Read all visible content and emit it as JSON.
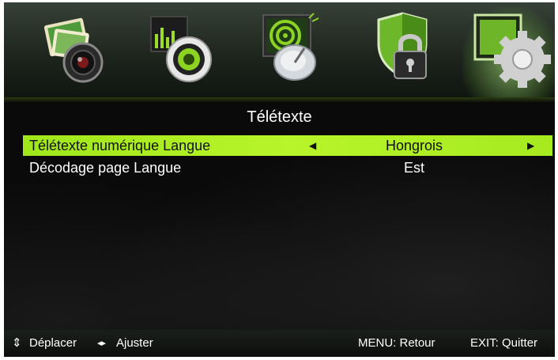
{
  "tabs": [
    {
      "icon": "picture-camera-icon"
    },
    {
      "icon": "sound-speaker-icon"
    },
    {
      "icon": "channel-satellite-icon"
    },
    {
      "icon": "lock-shield-icon"
    },
    {
      "icon": "settings-gear-icon",
      "active": true
    }
  ],
  "menu": {
    "title": "Télétexte",
    "items": [
      {
        "label": "Télétexte numérique Langue",
        "value": "Hongrois",
        "selected": true
      },
      {
        "label": "Décodage page Langue",
        "value": "Est",
        "selected": false
      }
    ]
  },
  "footer": {
    "move_glyph": "⇕",
    "move_label": "Déplacer",
    "adjust_glyph": "◂▸",
    "adjust_label": "Ajuster",
    "back_label": "MENU: Retour",
    "exit_label": "EXIT: Quitter"
  },
  "colors": {
    "highlight": "#b2f025",
    "background": "#090a09"
  }
}
